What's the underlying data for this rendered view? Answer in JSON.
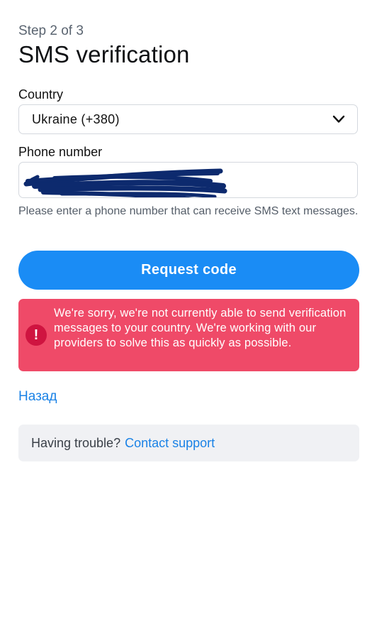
{
  "header": {
    "step": "Step 2 of 3",
    "title": "SMS verification"
  },
  "form": {
    "country_label": "Country",
    "country_value": "Ukraine (+380)",
    "phone_label": "Phone number",
    "phone_value": "",
    "phone_hint": "Please enter a phone number that can receive SMS text messages."
  },
  "actions": {
    "request_code": "Request code",
    "back": "Назад"
  },
  "error": {
    "message": "We're sorry, we're not currently able to send verification messages to your country. We're working with our providers to solve this as quickly as possible."
  },
  "support": {
    "text": "Having trouble?",
    "link": "Contact support"
  },
  "colors": {
    "primary": "#1a8cf5",
    "link": "#1a82e6",
    "error_bg": "#ef4a68",
    "error_icon": "#cf1440",
    "support_bg": "#f0f1f4",
    "redaction": "#0d2a6e"
  },
  "icons": {
    "country_dropdown": "chevron-down-icon",
    "error": "exclamation-circle-icon"
  }
}
